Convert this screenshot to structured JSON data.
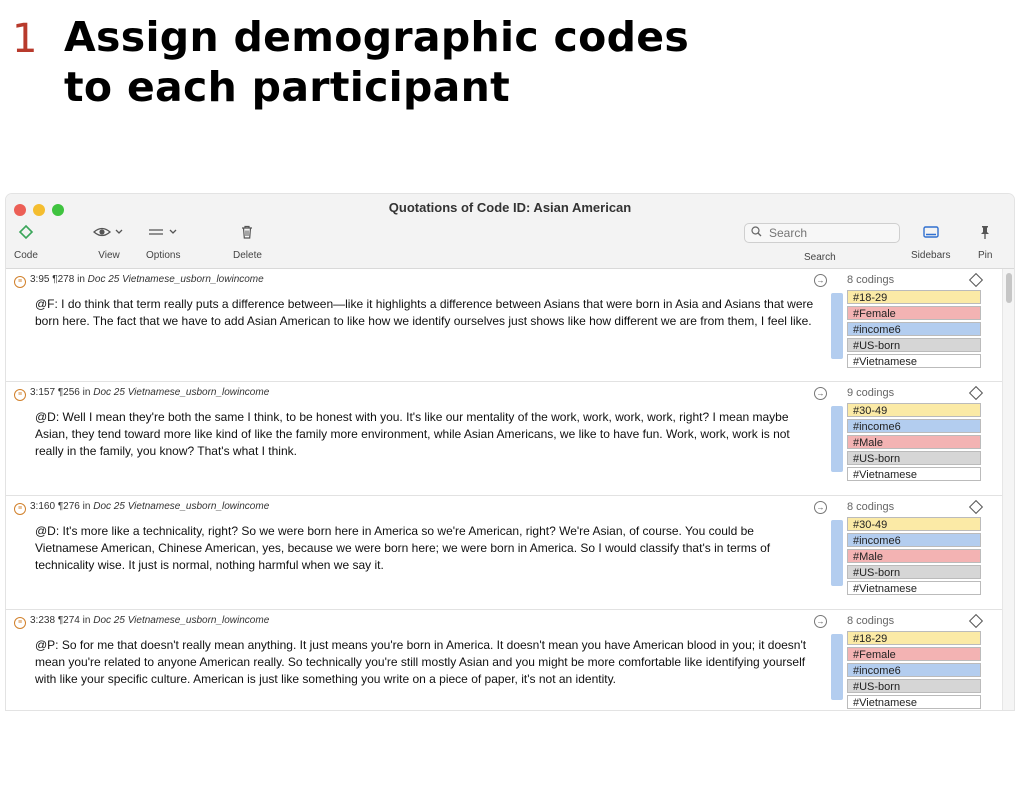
{
  "slide": {
    "step": "1",
    "title_line1": "Assign demographic codes",
    "title_line2": "to each participant"
  },
  "window": {
    "title": "Quotations of Code ID: Asian American"
  },
  "toolbar": {
    "code_label": "Code",
    "view_label": "View",
    "options_label": "Options",
    "delete_label": "Delete",
    "search_placeholder": "Search",
    "search_label": "Search",
    "sidebars_label": "Sidebars",
    "pin_label": "Pin"
  },
  "colors": {
    "yellow": "#fbeaa6",
    "pink": "#f3b3b3",
    "blue": "#b3cdef",
    "gray": "#d6d6d6",
    "white": "#ffffff"
  },
  "quotations": [
    {
      "id": "3:95",
      "para": "¶278",
      "in": "in",
      "doc": "Doc 25 Vietnamese_usborn_lowincome",
      "text": "@F:  I do think that term really puts a difference between—like it highlights a difference between Asians that were born in Asia and Asians that were born here.  The fact that we have to add Asian American to like how we identify ourselves just shows like how different we are from them, I feel like.",
      "count": "8 codings",
      "codes": [
        {
          "label": "#18-29",
          "color": "yellow"
        },
        {
          "label": "#Female",
          "color": "pink"
        },
        {
          "label": "#income6",
          "color": "blue"
        },
        {
          "label": "#US-born",
          "color": "gray"
        },
        {
          "label": "#Vietnamese",
          "color": "white"
        }
      ]
    },
    {
      "id": "3:157",
      "para": "¶256",
      "in": "in",
      "doc": "Doc 25 Vietnamese_usborn_lowincome",
      "text": "@D:  Well I mean they're both the same I think, to be honest with you.  It's like our mentality of the work, work, work, work, right?  I mean maybe Asian, they tend toward more like kind of like the family more environment, while Asian Americans, we like to have fun.  Work, work, work is not really in the family, you know?  That's what I think.",
      "count": "9 codings",
      "codes": [
        {
          "label": "#30-49",
          "color": "yellow"
        },
        {
          "label": "#income6",
          "color": "blue"
        },
        {
          "label": "#Male",
          "color": "pink"
        },
        {
          "label": "#US-born",
          "color": "gray"
        },
        {
          "label": "#Vietnamese",
          "color": "white"
        }
      ]
    },
    {
      "id": "3:160",
      "para": "¶276",
      "in": "in",
      "doc": "Doc 25 Vietnamese_usborn_lowincome",
      "text": "@D:  It's more like a technicality, right?  So we were born here in America so we're American, right?  We're Asian, of course.  You could be Vietnamese American, Chinese American, yes, because we were born here; we were born in America.  So I would classify that's in terms of technicality wise.  It just is normal, nothing harmful when we say it.",
      "count": "8 codings",
      "codes": [
        {
          "label": "#30-49",
          "color": "yellow"
        },
        {
          "label": "#income6",
          "color": "blue"
        },
        {
          "label": "#Male",
          "color": "pink"
        },
        {
          "label": "#US-born",
          "color": "gray"
        },
        {
          "label": "#Vietnamese",
          "color": "white"
        }
      ]
    },
    {
      "id": "3:238",
      "para": "¶274",
      "in": "in",
      "doc": "Doc 25 Vietnamese_usborn_lowincome",
      "text": "@P:  So for me that doesn't really mean anything.  It just means you're born in America.  It doesn't mean you have American blood in you; it doesn't mean you're related to anyone American really.  So technically you're still mostly Asian and you might be more comfortable like identifying yourself with like your specific culture.  American is just like something you write on a piece of paper, it's not an identity.",
      "count": "8 codings",
      "codes": [
        {
          "label": "#18-29",
          "color": "yellow"
        },
        {
          "label": "#Female",
          "color": "pink"
        },
        {
          "label": "#income6",
          "color": "blue"
        },
        {
          "label": "#US-born",
          "color": "gray"
        },
        {
          "label": "#Vietnamese",
          "color": "white"
        }
      ]
    }
  ]
}
